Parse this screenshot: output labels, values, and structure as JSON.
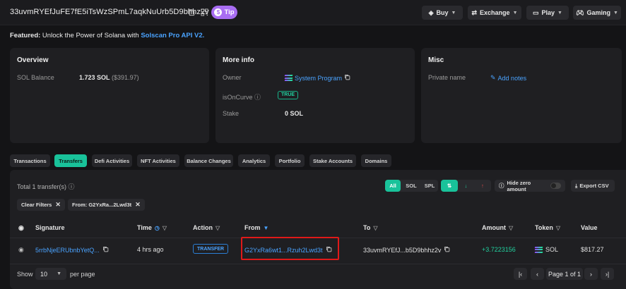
{
  "header": {
    "address": "33uvmRYEfJuFE7fE5iTsWzSPmL7aqkNuUrb5D9bhhz2v",
    "tip_label": "Tip",
    "nav": [
      {
        "label": "Buy",
        "icon": "buy-icon"
      },
      {
        "label": "Exchange",
        "icon": "exchange-icon"
      },
      {
        "label": "Play",
        "icon": "play-icon"
      },
      {
        "label": "Gaming",
        "icon": "gaming-icon"
      }
    ]
  },
  "featured": {
    "prefix": "Featured:",
    "text": " Unlock the Power of Solana with ",
    "link": "Solscan Pro API V2",
    "suffix": "."
  },
  "overview": {
    "title": "Overview",
    "sol_balance_label": "SOL Balance",
    "sol_balance_value": "1.723 SOL",
    "sol_balance_usd": "($391.97)"
  },
  "more_info": {
    "title": "More info",
    "owner_label": "Owner",
    "owner_value": "System Program",
    "is_on_curve_label": "isOnCurve",
    "is_on_curve_value": "TRUE",
    "stake_label": "Stake",
    "stake_value": "0 SOL"
  },
  "misc": {
    "title": "Misc",
    "private_name_label": "Private name",
    "add_notes_label": "Add notes"
  },
  "tabs": [
    {
      "label": "Transactions",
      "active": false
    },
    {
      "label": "Transfers",
      "active": true
    },
    {
      "label": "Defi Activities",
      "active": false
    },
    {
      "label": "NFT Activities",
      "active": false
    },
    {
      "label": "Balance Changes",
      "active": false
    },
    {
      "label": "Analytics",
      "active": false
    },
    {
      "label": "Portfolio",
      "active": false
    },
    {
      "label": "Stake Accounts",
      "active": false
    },
    {
      "label": "Domains",
      "active": false
    }
  ],
  "transfers": {
    "total_text": "Total 1 transfer(s)",
    "token_filters": [
      "All",
      "SOL",
      "SPL"
    ],
    "active_token_filter": "All",
    "hide_zero_label": "Hide zero amount",
    "export_label": "Export CSV",
    "chips": [
      "Clear Filters",
      "From: G2YxRa...2Lwd3t"
    ],
    "columns": [
      "Signature",
      "Time",
      "Action",
      "From",
      "To",
      "Amount",
      "Token",
      "Value"
    ],
    "rows": [
      {
        "signature": "5rrbNjeERUbnbYetQ...",
        "time": "4 hrs ago",
        "action": "TRANSFER",
        "from": "G2YxRa6wt1...Rzuh2Lwd3t",
        "to": "33uvmRYEfJ...b5D9bhhz2v",
        "amount": "+3.7223156",
        "token": "SOL",
        "value": "$817.27"
      }
    ],
    "show_label": "Show",
    "page_size": "10",
    "per_page_label": "per page",
    "page_text": "Page 1 of 1"
  },
  "colors": {
    "accent": "#19c29a",
    "link": "#4aa3ff",
    "tip": "#a86df2",
    "highlight": "#e01919"
  }
}
